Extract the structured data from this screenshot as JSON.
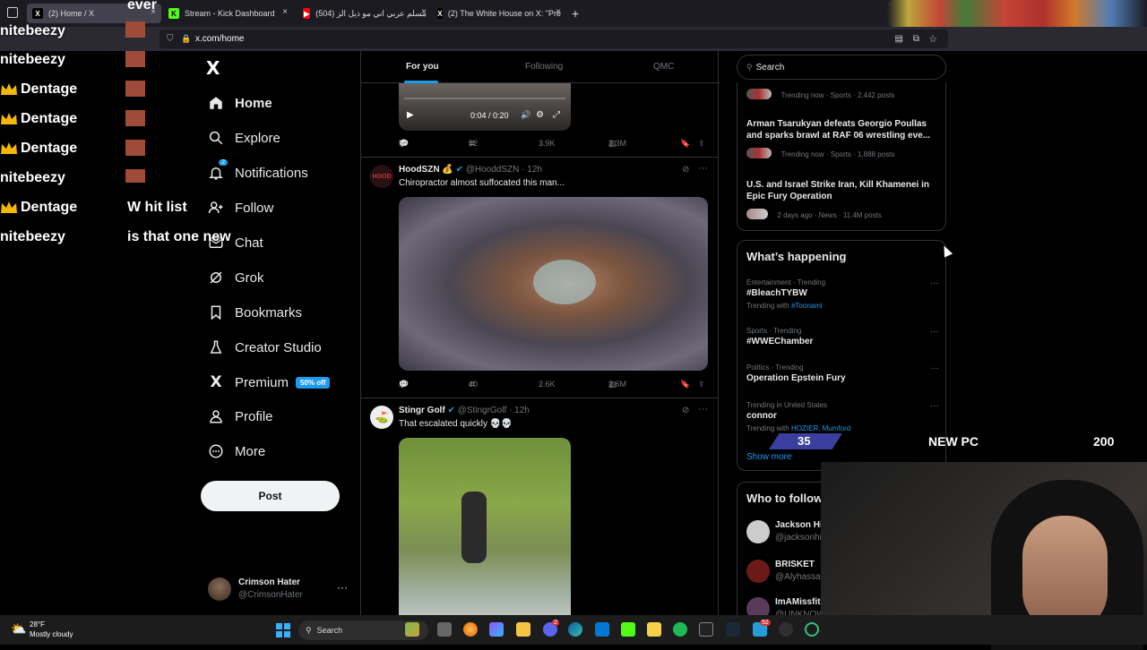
{
  "browser": {
    "tabs": [
      {
        "label": "(2) Home / X",
        "active": true
      },
      {
        "label": "Stream - Kick Dashboard",
        "active": false
      },
      {
        "label": "(504) مسلم عربي اني مو ذيل الز",
        "active": false
      },
      {
        "label": "(2) The White House on X: \"Pre",
        "active": false
      }
    ],
    "new_tab": "+",
    "url": "x.com/home"
  },
  "sidebar": {
    "logo": "X",
    "items": [
      {
        "label": "Home",
        "icon": "home-icon",
        "bold": true
      },
      {
        "label": "Explore",
        "icon": "search-icon"
      },
      {
        "label": "Notifications",
        "icon": "bell-icon",
        "badge": "2"
      },
      {
        "label": "Follow",
        "icon": "add-person-icon"
      },
      {
        "label": "Chat",
        "icon": "mail-icon"
      },
      {
        "label": "Grok",
        "icon": "grok-icon"
      },
      {
        "label": "Bookmarks",
        "icon": "bookmark-icon"
      },
      {
        "label": "Creator Studio",
        "icon": "flask-icon"
      },
      {
        "label": "Premium",
        "icon": "x-icon",
        "tag": "50% off"
      },
      {
        "label": "Profile",
        "icon": "person-icon"
      },
      {
        "label": "More",
        "icon": "more-circle-icon"
      }
    ],
    "post_button": "Post",
    "account": {
      "name": "Crimson Hater",
      "handle": "@CrimsonHater"
    }
  },
  "feed": {
    "tabs": [
      "For you",
      "Following",
      "QMC"
    ],
    "video_time": "0:04 / 0:20",
    "first_actions": {
      "replies": "56",
      "reposts": "52",
      "likes": "3.9K",
      "views": "2.3M"
    },
    "tweets": [
      {
        "name": "HoodSZN",
        "handle": "@HooddSZN",
        "time": "12h",
        "emoji": "💰",
        "text": "Chiropractor almost suffocated this man...",
        "replies": "39",
        "reposts": "40",
        "likes": "2.6K",
        "views": "2.6M"
      },
      {
        "name": "Stingr Golf",
        "handle": "@StingrGolf",
        "time": "12h",
        "emoji": "",
        "text": "That escalated quickly 💀💀"
      }
    ]
  },
  "right": {
    "search_placeholder": "Search",
    "trends_top": [
      {
        "meta": "Trending now · Sports · 2,442 posts",
        "title": ""
      },
      {
        "title": "Arman Tsarukyan defeats Georgio Poullas and sparks brawl at RAF 06 wrestling eve...",
        "meta": "Trending now · Sports · 1,888 posts"
      },
      {
        "title": "U.S. and Israel Strike Iran, Kill Khamenei in Epic Fury Operation",
        "meta": "2 days ago · News · 11.4M posts"
      }
    ],
    "whats_happening": {
      "title": "What’s happening",
      "items": [
        {
          "category": "Entertainment · Trending",
          "title": "#BleachTYBW",
          "extra": "Trending with",
          "link": "#Toonami"
        },
        {
          "category": "Sports · Trending",
          "title": "#WWEChamber",
          "extra": "",
          "link": ""
        },
        {
          "category": "Politics · Trending",
          "title": "Operation Epstein Fury",
          "extra": "",
          "link": ""
        },
        {
          "category": "Trending in United States",
          "title": "connor",
          "extra": "Trending with",
          "link": "HOZIER, Mumford"
        }
      ],
      "show_more": "Show more"
    },
    "who_to_follow": {
      "title": "Who to follow",
      "users": [
        {
          "name": "Jackson Hi",
          "handle": "@jacksonhi"
        },
        {
          "name": "BRISKET",
          "handle": "@Alyhassan"
        },
        {
          "name": "ImAMissfit",
          "handle": "@UNKNOW"
        }
      ]
    }
  },
  "overlay": {
    "top_word": "ever",
    "chat": [
      {
        "user": "nitebeezy",
        "crown": false,
        "msg": ""
      },
      {
        "user": "nitebeezy",
        "crown": false,
        "msg": ""
      },
      {
        "user": "Dentage",
        "crown": true,
        "msg": ""
      },
      {
        "user": "Dentage",
        "crown": true,
        "msg": ""
      },
      {
        "user": "Dentage",
        "crown": true,
        "msg": ""
      },
      {
        "user": "nitebeezy",
        "crown": false,
        "msg": ""
      },
      {
        "user": "Dentage",
        "crown": true,
        "msg": "W hit list"
      },
      {
        "user": "nitebeezy",
        "crown": false,
        "msg": "is that one new"
      }
    ],
    "goal_left": "35",
    "goal_label": "NEW PC",
    "goal_right": "200"
  },
  "taskbar": {
    "weather_temp": "28°F",
    "weather_desc": "Mostly cloudy",
    "search": "Search",
    "badge_a": "2",
    "badge_b": "52"
  },
  "colors": {
    "accent": "#1d9bf0",
    "premium_tag": "#1d9bf0",
    "goal_bar": "#3a3f9e"
  }
}
